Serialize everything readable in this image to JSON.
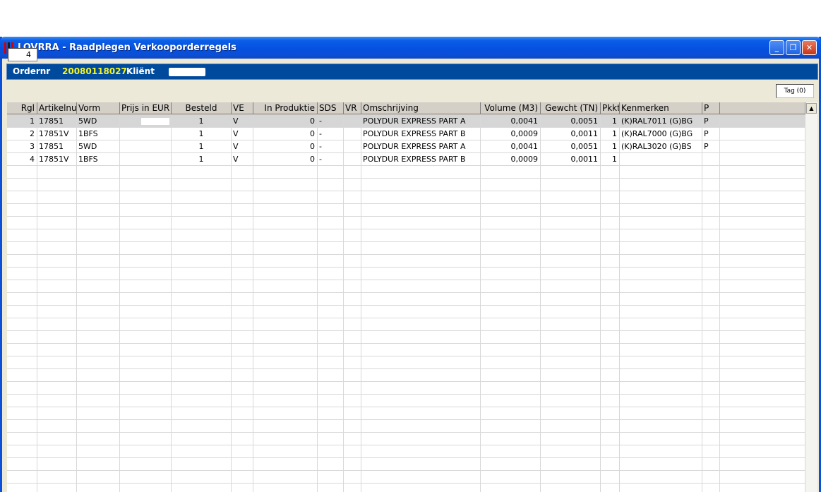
{
  "window": {
    "title": "LOVRRA - Raadplegen Verkooporderregels",
    "controls": {
      "minimize": "_",
      "restore": "❐",
      "close": "✕"
    }
  },
  "order": {
    "ordernr_label": "Ordernr",
    "ordernr_value": "20080118027",
    "client_label": "Kliënt"
  },
  "toolbar": {
    "count": "4",
    "tag_label": "Tag (0)"
  },
  "grid": {
    "columns": [
      "Rgl",
      "Artikelnu",
      "Vorm",
      "Prijs in EUR",
      "Besteld",
      "VE",
      "In Produktie",
      "SDS",
      "VR",
      "Omschrijving",
      "Volume (M3)",
      "Gewcht (TN)",
      "Pkkt.",
      "Kenmerken",
      "P"
    ],
    "rows": [
      {
        "rgl": "1",
        "artikel": "17851",
        "vorm": "5WD",
        "besteld": "1",
        "ve": "V",
        "produktie": "0",
        "sds": "-",
        "vr": "",
        "omschrijving": "POLYDUR EXPRESS PART A",
        "volume": "0,0041",
        "gewicht": "0,0051",
        "pkkt": "1",
        "kenmerken": "(K)RAL7011 (G)BG",
        "p": "P"
      },
      {
        "rgl": "2",
        "artikel": "17851V",
        "vorm": "1BFS",
        "besteld": "1",
        "ve": "V",
        "produktie": "0",
        "sds": "-",
        "vr": "",
        "omschrijving": "POLYDUR EXPRESS PART B",
        "volume": "0,0009",
        "gewicht": "0,0011",
        "pkkt": "1",
        "kenmerken": "(K)RAL7000 (G)BG",
        "p": "P"
      },
      {
        "rgl": "3",
        "artikel": "17851",
        "vorm": "5WD",
        "besteld": "1",
        "ve": "V",
        "produktie": "0",
        "sds": "-",
        "vr": "",
        "omschrijving": "POLYDUR EXPRESS PART A",
        "volume": "0,0041",
        "gewicht": "0,0051",
        "pkkt": "1",
        "kenmerken": "(K)RAL3020 (G)BS",
        "p": "P"
      },
      {
        "rgl": "4",
        "artikel": "17851V",
        "vorm": "1BFS",
        "besteld": "1",
        "ve": "V",
        "produktie": "0",
        "sds": "-",
        "vr": "",
        "omschrijving": "POLYDUR EXPRESS PART B",
        "volume": "0,0009",
        "gewicht": "0,0011",
        "pkkt": "1",
        "kenmerken": "",
        "p": ""
      }
    ],
    "selected_row": 0
  },
  "scrollbar": {
    "up_arrow": "▲"
  },
  "colors": {
    "order_bar": "#004a9e",
    "ordernr_value": "#f5f520",
    "selection": "#d6d6d6"
  }
}
